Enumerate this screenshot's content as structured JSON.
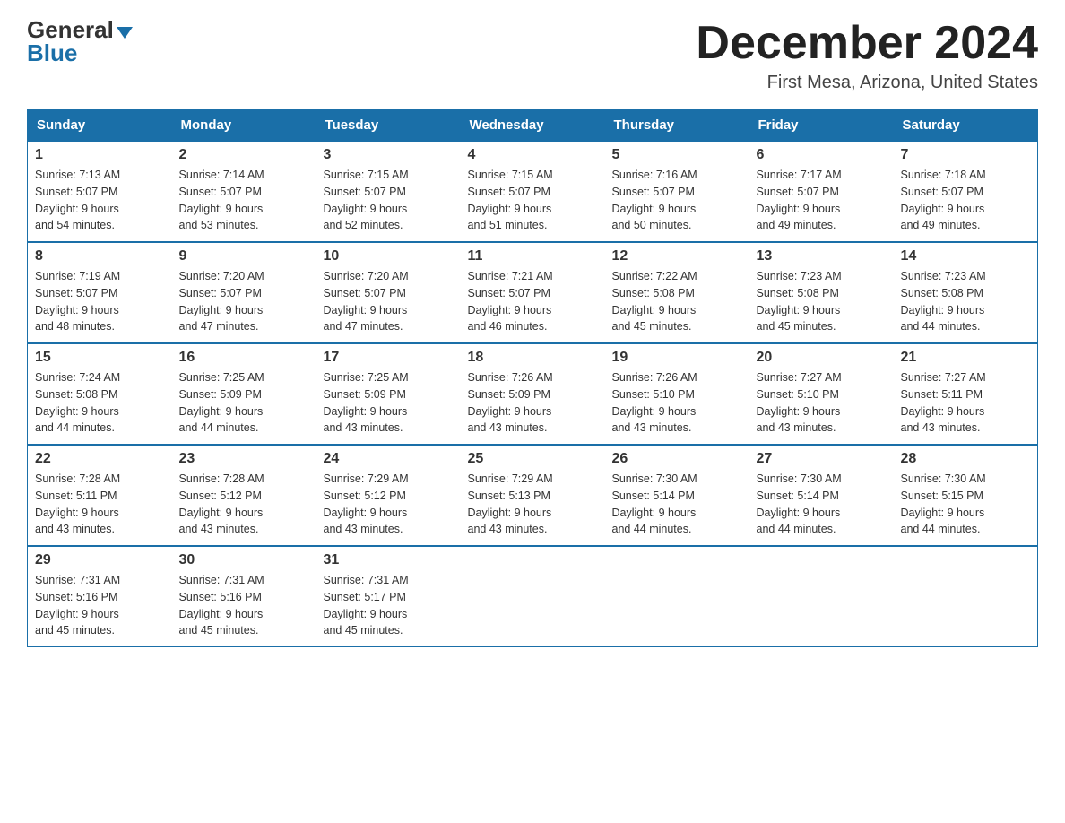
{
  "logo": {
    "general": "General",
    "blue": "Blue"
  },
  "title": "December 2024",
  "location": "First Mesa, Arizona, United States",
  "days_of_week": [
    "Sunday",
    "Monday",
    "Tuesday",
    "Wednesday",
    "Thursday",
    "Friday",
    "Saturday"
  ],
  "weeks": [
    [
      {
        "day": "1",
        "sunrise": "7:13 AM",
        "sunset": "5:07 PM",
        "daylight": "9 hours and 54 minutes."
      },
      {
        "day": "2",
        "sunrise": "7:14 AM",
        "sunset": "5:07 PM",
        "daylight": "9 hours and 53 minutes."
      },
      {
        "day": "3",
        "sunrise": "7:15 AM",
        "sunset": "5:07 PM",
        "daylight": "9 hours and 52 minutes."
      },
      {
        "day": "4",
        "sunrise": "7:15 AM",
        "sunset": "5:07 PM",
        "daylight": "9 hours and 51 minutes."
      },
      {
        "day": "5",
        "sunrise": "7:16 AM",
        "sunset": "5:07 PM",
        "daylight": "9 hours and 50 minutes."
      },
      {
        "day": "6",
        "sunrise": "7:17 AM",
        "sunset": "5:07 PM",
        "daylight": "9 hours and 49 minutes."
      },
      {
        "day": "7",
        "sunrise": "7:18 AM",
        "sunset": "5:07 PM",
        "daylight": "9 hours and 49 minutes."
      }
    ],
    [
      {
        "day": "8",
        "sunrise": "7:19 AM",
        "sunset": "5:07 PM",
        "daylight": "9 hours and 48 minutes."
      },
      {
        "day": "9",
        "sunrise": "7:20 AM",
        "sunset": "5:07 PM",
        "daylight": "9 hours and 47 minutes."
      },
      {
        "day": "10",
        "sunrise": "7:20 AM",
        "sunset": "5:07 PM",
        "daylight": "9 hours and 47 minutes."
      },
      {
        "day": "11",
        "sunrise": "7:21 AM",
        "sunset": "5:07 PM",
        "daylight": "9 hours and 46 minutes."
      },
      {
        "day": "12",
        "sunrise": "7:22 AM",
        "sunset": "5:08 PM",
        "daylight": "9 hours and 45 minutes."
      },
      {
        "day": "13",
        "sunrise": "7:23 AM",
        "sunset": "5:08 PM",
        "daylight": "9 hours and 45 minutes."
      },
      {
        "day": "14",
        "sunrise": "7:23 AM",
        "sunset": "5:08 PM",
        "daylight": "9 hours and 44 minutes."
      }
    ],
    [
      {
        "day": "15",
        "sunrise": "7:24 AM",
        "sunset": "5:08 PM",
        "daylight": "9 hours and 44 minutes."
      },
      {
        "day": "16",
        "sunrise": "7:25 AM",
        "sunset": "5:09 PM",
        "daylight": "9 hours and 44 minutes."
      },
      {
        "day": "17",
        "sunrise": "7:25 AM",
        "sunset": "5:09 PM",
        "daylight": "9 hours and 43 minutes."
      },
      {
        "day": "18",
        "sunrise": "7:26 AM",
        "sunset": "5:09 PM",
        "daylight": "9 hours and 43 minutes."
      },
      {
        "day": "19",
        "sunrise": "7:26 AM",
        "sunset": "5:10 PM",
        "daylight": "9 hours and 43 minutes."
      },
      {
        "day": "20",
        "sunrise": "7:27 AM",
        "sunset": "5:10 PM",
        "daylight": "9 hours and 43 minutes."
      },
      {
        "day": "21",
        "sunrise": "7:27 AM",
        "sunset": "5:11 PM",
        "daylight": "9 hours and 43 minutes."
      }
    ],
    [
      {
        "day": "22",
        "sunrise": "7:28 AM",
        "sunset": "5:11 PM",
        "daylight": "9 hours and 43 minutes."
      },
      {
        "day": "23",
        "sunrise": "7:28 AM",
        "sunset": "5:12 PM",
        "daylight": "9 hours and 43 minutes."
      },
      {
        "day": "24",
        "sunrise": "7:29 AM",
        "sunset": "5:12 PM",
        "daylight": "9 hours and 43 minutes."
      },
      {
        "day": "25",
        "sunrise": "7:29 AM",
        "sunset": "5:13 PM",
        "daylight": "9 hours and 43 minutes."
      },
      {
        "day": "26",
        "sunrise": "7:30 AM",
        "sunset": "5:14 PM",
        "daylight": "9 hours and 44 minutes."
      },
      {
        "day": "27",
        "sunrise": "7:30 AM",
        "sunset": "5:14 PM",
        "daylight": "9 hours and 44 minutes."
      },
      {
        "day": "28",
        "sunrise": "7:30 AM",
        "sunset": "5:15 PM",
        "daylight": "9 hours and 44 minutes."
      }
    ],
    [
      {
        "day": "29",
        "sunrise": "7:31 AM",
        "sunset": "5:16 PM",
        "daylight": "9 hours and 45 minutes."
      },
      {
        "day": "30",
        "sunrise": "7:31 AM",
        "sunset": "5:16 PM",
        "daylight": "9 hours and 45 minutes."
      },
      {
        "day": "31",
        "sunrise": "7:31 AM",
        "sunset": "5:17 PM",
        "daylight": "9 hours and 45 minutes."
      },
      null,
      null,
      null,
      null
    ]
  ],
  "labels": {
    "sunrise": "Sunrise:",
    "sunset": "Sunset:",
    "daylight": "Daylight:"
  }
}
